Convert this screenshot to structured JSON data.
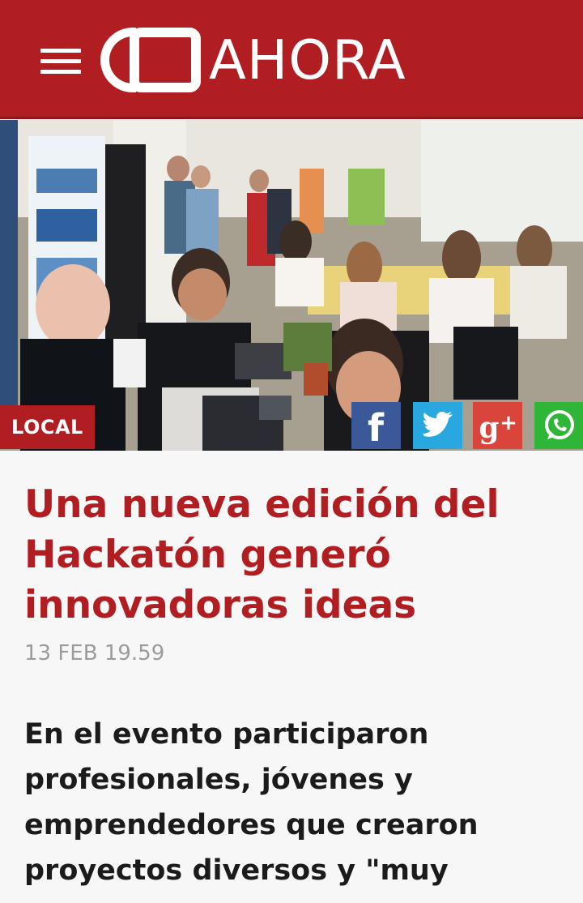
{
  "header": {
    "logo_text": "AHORA",
    "menu_icon": "hamburger-menu-icon",
    "brand_color": "#b11e22"
  },
  "hero": {
    "image": "photo of hackathon participants working on laptops",
    "section_badge": "LOCAL"
  },
  "share": {
    "buttons": [
      {
        "network": "facebook",
        "icon": "facebook-icon",
        "color": "#3b5998"
      },
      {
        "network": "twitter",
        "icon": "twitter-icon",
        "color": "#29a8e0"
      },
      {
        "network": "google-plus",
        "icon": "google-plus-icon",
        "color": "#d9453a"
      },
      {
        "network": "whatsapp",
        "icon": "whatsapp-icon",
        "color": "#2fb538"
      }
    ]
  },
  "article": {
    "title": "Una nueva edición del Hackatón generó innovadoras ideas",
    "date": "13 FEB 19.59",
    "lead": "En el evento participaron profesionales, jóvenes y emprendedores que crearon proyectos diversos y \"muy"
  }
}
